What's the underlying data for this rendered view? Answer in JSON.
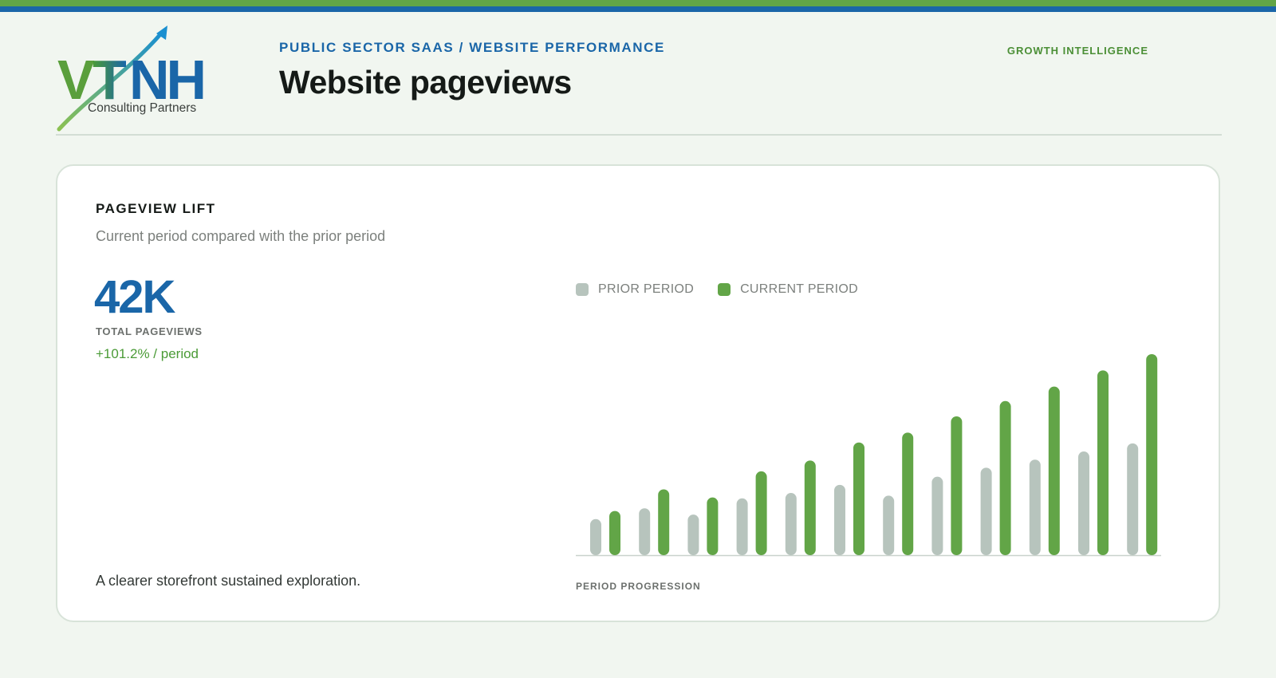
{
  "header": {
    "kicker": "PUBLIC SECTOR SAAS / WEBSITE PERFORMANCE",
    "title": "Website pageviews",
    "section_tag": "GROWTH INTELLIGENCE"
  },
  "logo": {
    "wordmark": "VTNH",
    "tagline": "Consulting Partners"
  },
  "card": {
    "title": "PAGEVIEW LIFT",
    "subtitle": "Current period compared with the prior period",
    "kpi": {
      "value": "42K",
      "label": "TOTAL PAGEVIEWS",
      "change": "+101.2% / period"
    },
    "footnote": "A clearer storefront sustained exploration."
  },
  "colors": {
    "prior": "#b7c4bd",
    "current": "#62a547",
    "brand_blue": "#1a66a8",
    "brand_green": "#62a547"
  },
  "chart_data": {
    "type": "bar",
    "legend_position": "top-left",
    "grid": false,
    "xlabel": "PERIOD PROGRESSION",
    "series": [
      {
        "name": "PRIOR PERIOD",
        "values": [
          40,
          52,
          45,
          63,
          69,
          78,
          66,
          87,
          97,
          106,
          115,
          124
        ]
      },
      {
        "name": "CURRENT PERIOD",
        "values": [
          49,
          73,
          64,
          93,
          105,
          125,
          136,
          154,
          171,
          187,
          205,
          223
        ]
      }
    ],
    "ylim": [
      0,
      223
    ]
  }
}
